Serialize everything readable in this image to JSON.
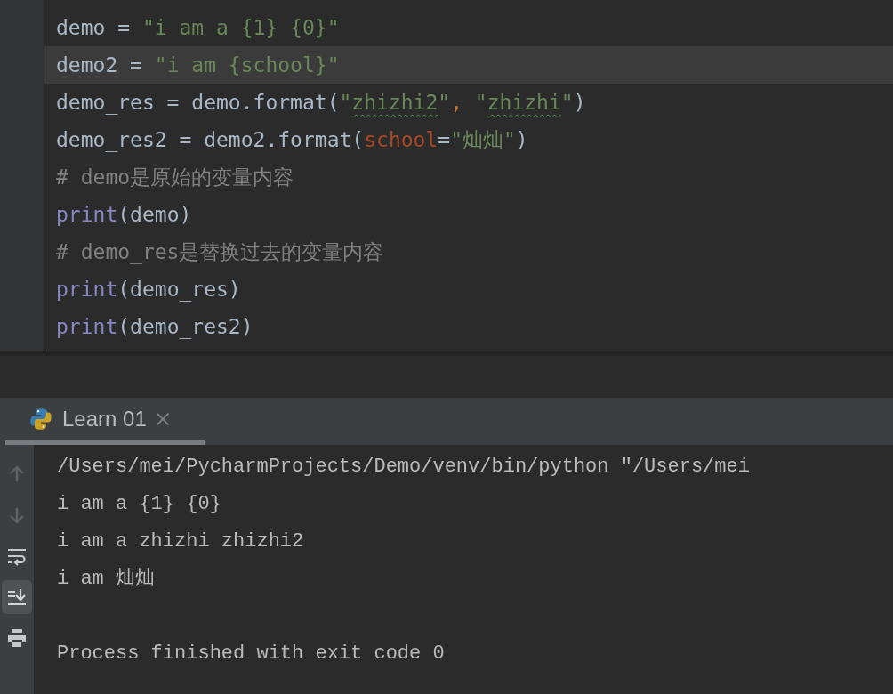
{
  "editor": {
    "lines": [
      {
        "current": false,
        "tokens": [
          {
            "kind": "plain",
            "text": "demo = "
          },
          {
            "kind": "string",
            "text": "\"i am a {1} {0}\""
          }
        ]
      },
      {
        "current": true,
        "tokens": [
          {
            "kind": "plain",
            "text": "demo2 = "
          },
          {
            "kind": "string",
            "text": "\"i am {school}\""
          }
        ]
      },
      {
        "current": false,
        "tokens": [
          {
            "kind": "plain",
            "text": "demo_res = demo.format("
          },
          {
            "kind": "string",
            "text": "\""
          },
          {
            "kind": "string",
            "text": "zhizhi2",
            "warning": true
          },
          {
            "kind": "string",
            "text": "\""
          },
          {
            "kind": "comma",
            "text": ", "
          },
          {
            "kind": "string",
            "text": "\""
          },
          {
            "kind": "string",
            "text": "zhizhi",
            "warning": true
          },
          {
            "kind": "string",
            "text": "\""
          },
          {
            "kind": "plain",
            "text": ")"
          }
        ]
      },
      {
        "current": false,
        "tokens": [
          {
            "kind": "plain",
            "text": "demo_res2 = demo2.format("
          },
          {
            "kind": "param",
            "text": "school"
          },
          {
            "kind": "plain",
            "text": "="
          },
          {
            "kind": "string",
            "text": "\"灿灿\""
          },
          {
            "kind": "plain",
            "text": ")"
          }
        ]
      },
      {
        "current": false,
        "tokens": [
          {
            "kind": "comment",
            "text": "# demo是原始的变量内容"
          }
        ]
      },
      {
        "current": false,
        "tokens": [
          {
            "kind": "builtin",
            "text": "print"
          },
          {
            "kind": "plain",
            "text": "(demo)"
          }
        ]
      },
      {
        "current": false,
        "tokens": [
          {
            "kind": "comment",
            "text": "# demo_res是替换过去的变量内容"
          }
        ]
      },
      {
        "current": false,
        "tokens": [
          {
            "kind": "builtin",
            "text": "print"
          },
          {
            "kind": "plain",
            "text": "(demo_res)"
          }
        ]
      },
      {
        "current": false,
        "tokens": [
          {
            "kind": "builtin",
            "text": "print"
          },
          {
            "kind": "plain",
            "text": "(demo_res2)"
          }
        ]
      }
    ]
  },
  "run_tabs": [
    {
      "label": "Learn 01",
      "selected": true
    }
  ],
  "console_toolbar": [
    {
      "kind": "up",
      "selected": false
    },
    {
      "kind": "down",
      "selected": false
    },
    {
      "kind": "wrap",
      "selected": false
    },
    {
      "kind": "scroll_end",
      "selected": true
    },
    {
      "kind": "print",
      "selected": false
    }
  ],
  "console_lines": [
    "/Users/mei/PycharmProjects/Demo/venv/bin/python \"/Users/mei",
    "i am a {1} {0}",
    "i am a zhizhi zhizhi2",
    "i am 灿灿"
  ],
  "exit_message": "Process finished with exit code 0"
}
